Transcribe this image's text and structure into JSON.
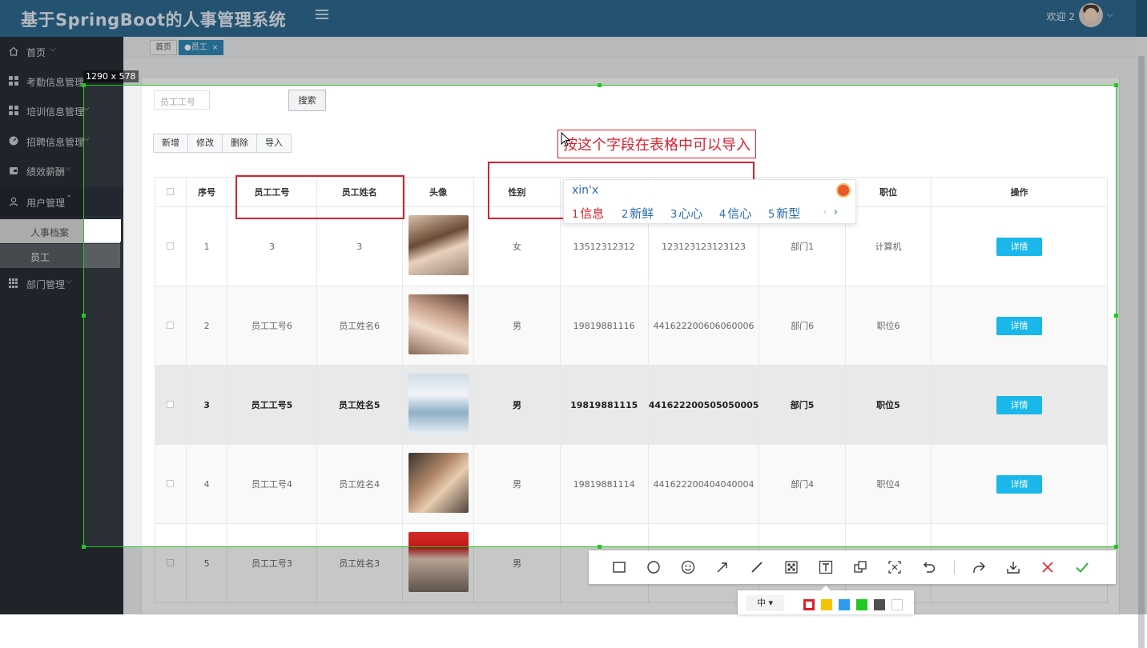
{
  "header": {
    "title": "基于SpringBoot的人事管理系统",
    "welcome": "欢迎 2"
  },
  "sidebar": {
    "items": [
      {
        "label": "首页",
        "icon": "home-icon"
      },
      {
        "label": "考勤信息管理",
        "icon": "grid-icon"
      },
      {
        "label": "培训信息管理",
        "icon": "grid-icon"
      },
      {
        "label": "招聘信息管理",
        "icon": "gauge-icon"
      },
      {
        "label": "绩效薪酬",
        "icon": "wallet-icon"
      },
      {
        "label": "用户管理",
        "icon": "user-icon"
      },
      {
        "label": "部门管理",
        "icon": "grid9-icon"
      }
    ],
    "sub_items": [
      {
        "label": "人事档案"
      },
      {
        "label": "员工"
      }
    ]
  },
  "tabs": [
    {
      "label": "首页"
    },
    {
      "label": "●员工"
    }
  ],
  "search": {
    "placeholder": "员工工号",
    "button": "搜索"
  },
  "actions": {
    "add": "新增",
    "edit": "修改",
    "delete": "删除",
    "import": "导入"
  },
  "table": {
    "columns": [
      "序号",
      "员工工号",
      "员工姓名",
      "头像",
      "性别",
      "",
      "",
      "",
      "职位",
      "操作"
    ],
    "rows": [
      {
        "index": "1",
        "emp_no": "3",
        "emp_name": "3",
        "gender": "女",
        "phone": "13512312312",
        "id_card": "123123123123123",
        "dept": "部门1",
        "position": "计算机",
        "action": "详情"
      },
      {
        "index": "2",
        "emp_no": "员工工号6",
        "emp_name": "员工姓名6",
        "gender": "男",
        "phone": "19819881116",
        "id_card": "441622200606060006",
        "dept": "部门6",
        "position": "职位6",
        "action": "详情"
      },
      {
        "index": "3",
        "emp_no": "员工工号5",
        "emp_name": "员工姓名5",
        "gender": "男",
        "phone": "19819881115",
        "id_card": "441622200505050005",
        "dept": "部门5",
        "position": "职位5",
        "action": "详情"
      },
      {
        "index": "4",
        "emp_no": "员工工号4",
        "emp_name": "员工姓名4",
        "gender": "男",
        "phone": "19819881114",
        "id_card": "441622200404040004",
        "dept": "部门4",
        "position": "职位4",
        "action": "详情"
      },
      {
        "index": "5",
        "emp_no": "员工工号3",
        "emp_name": "员工姓名3",
        "gender": "男",
        "phone": "",
        "id_card": "",
        "dept": "",
        "position": "",
        "action": ""
      }
    ]
  },
  "overlay": {
    "size_label": "1290 x 578",
    "annotation_text": "按这个字段在表格中可以导入",
    "ime": {
      "input": "xin'x",
      "candidates": [
        {
          "n": "1",
          "text": "信息"
        },
        {
          "n": "2",
          "text": "新鲜"
        },
        {
          "n": "3",
          "text": "心心"
        },
        {
          "n": "4",
          "text": "信心"
        },
        {
          "n": "5",
          "text": "新型"
        }
      ]
    },
    "font_size": "中",
    "colors": [
      "#d8202e",
      "#f5c400",
      "#2d9cf0",
      "#22c822",
      "#505050",
      "#ffffff"
    ]
  }
}
